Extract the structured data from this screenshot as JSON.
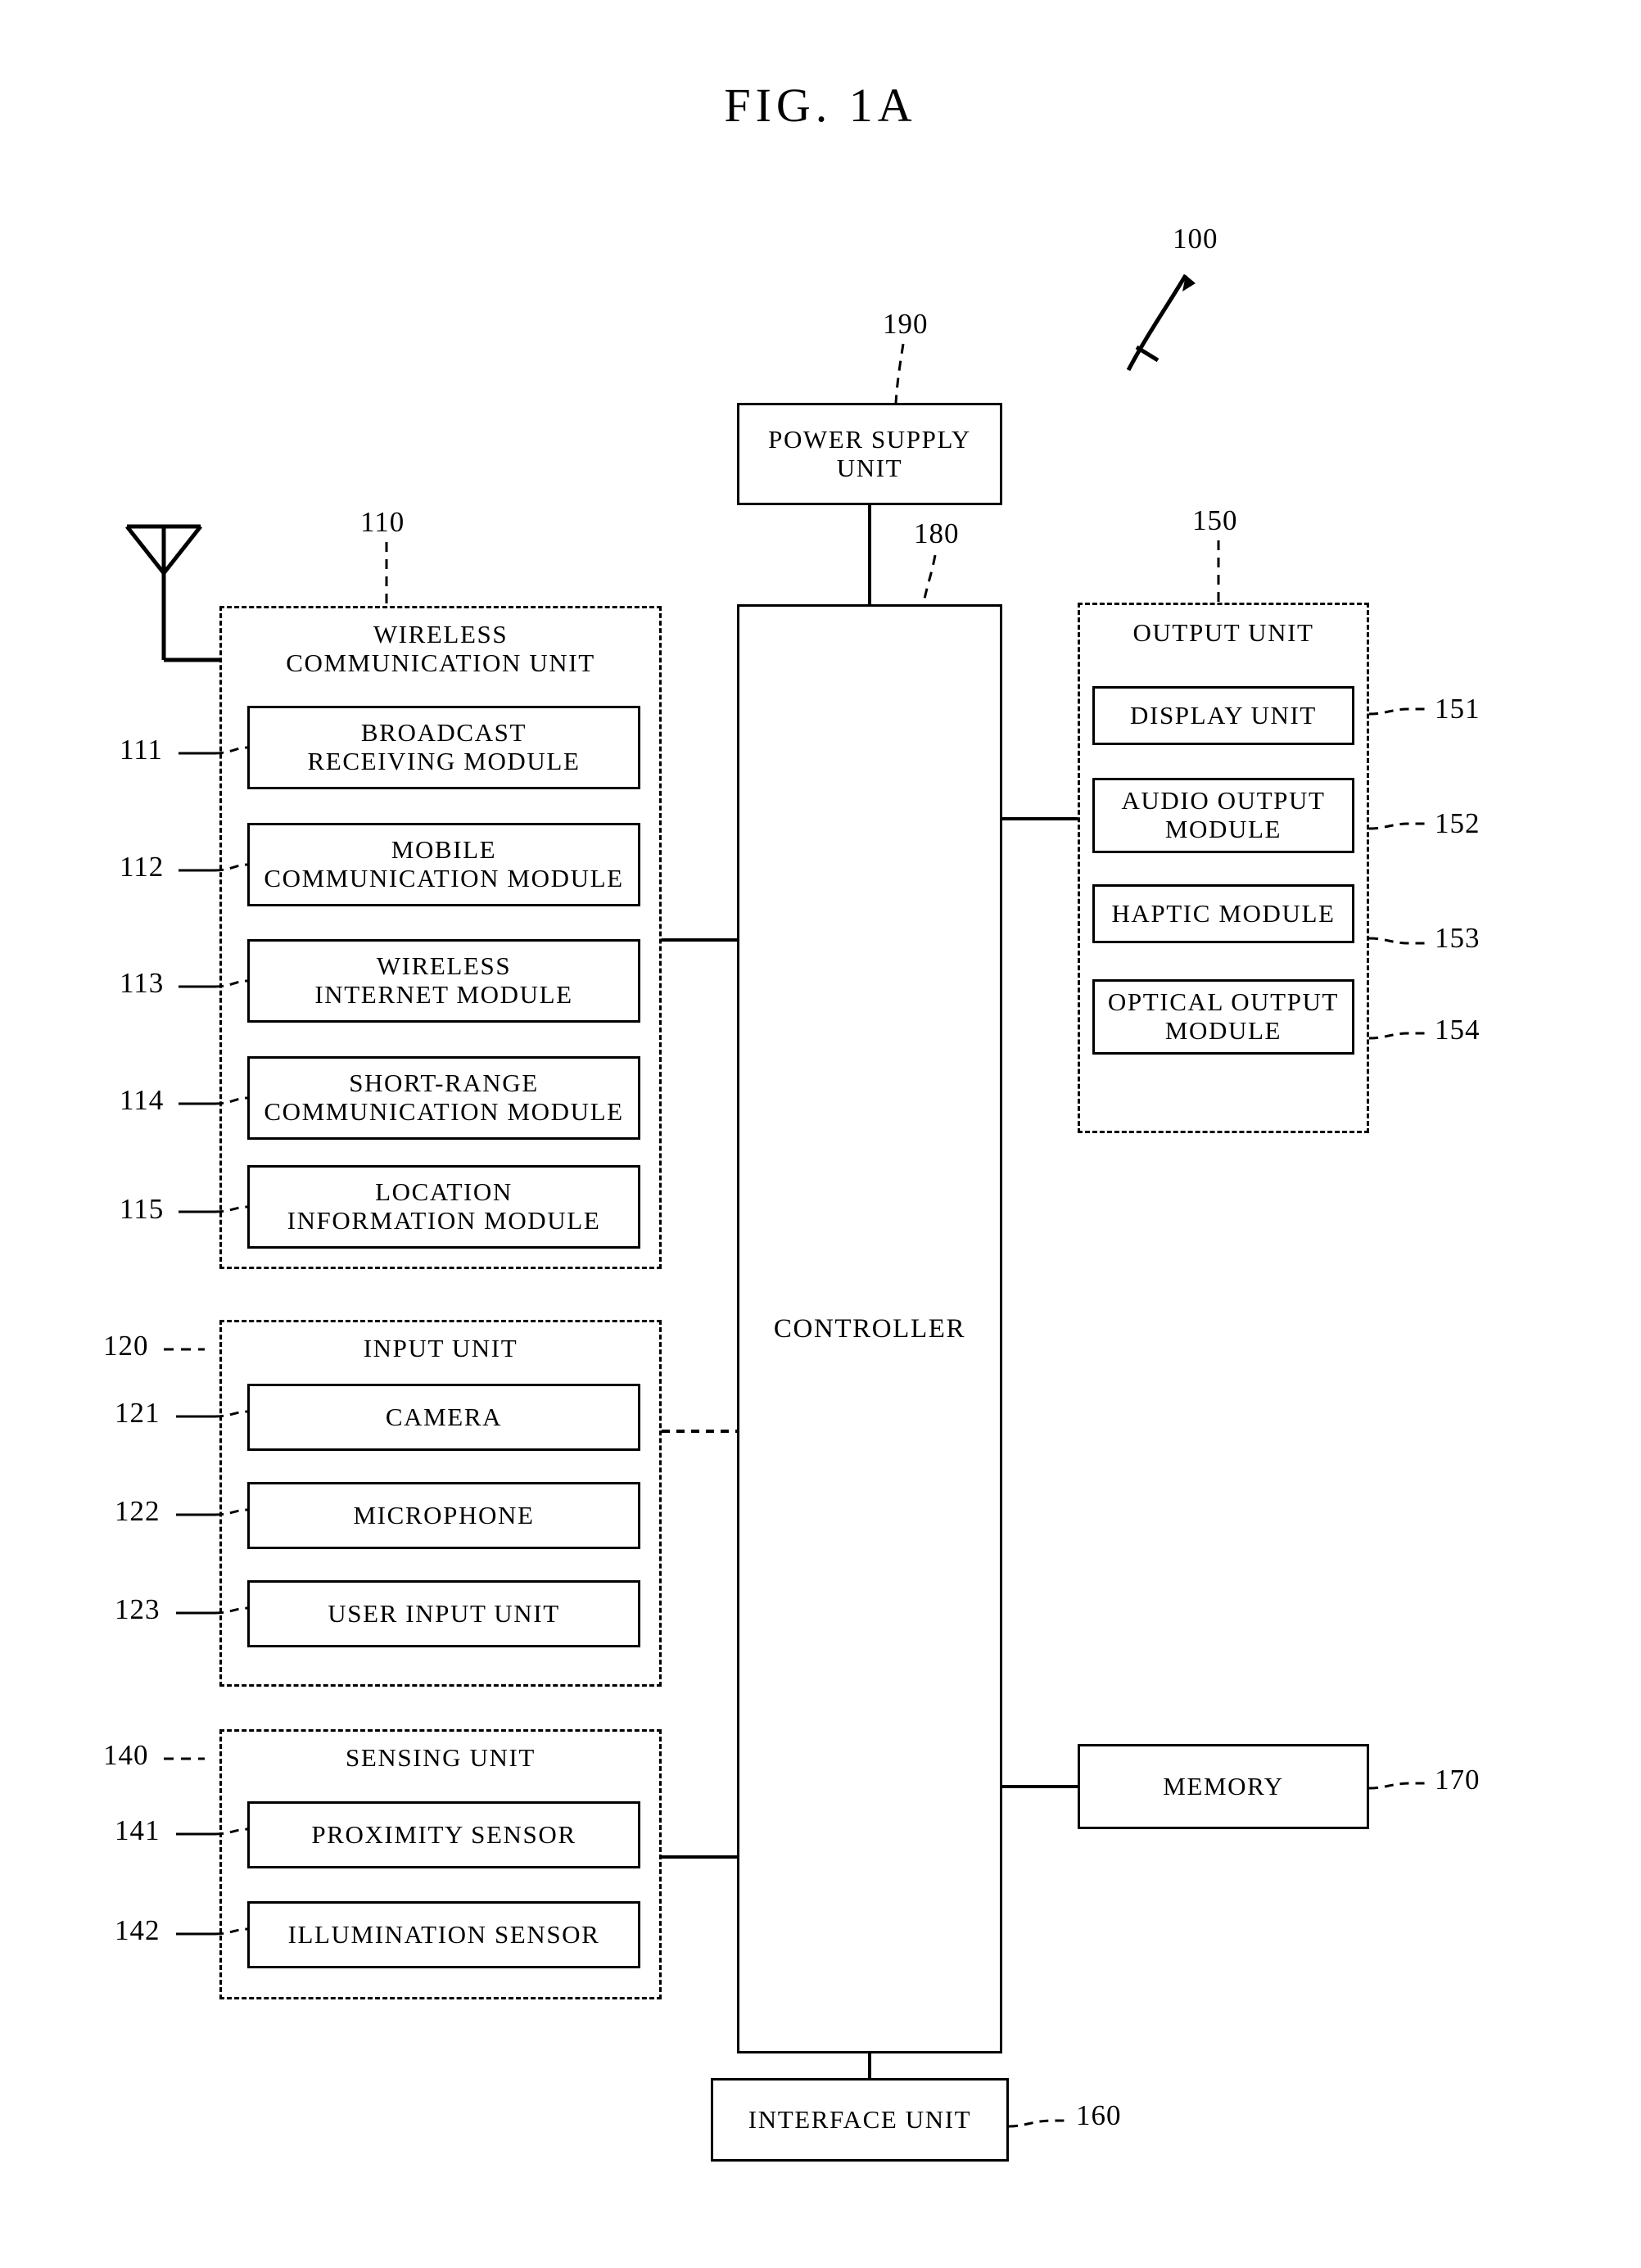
{
  "figure": {
    "title": "FIG.  1A",
    "device_ref": "100"
  },
  "power_supply": {
    "label": "POWER SUPPLY\nUNIT",
    "ref": "190"
  },
  "controller": {
    "label": "CONTROLLER",
    "ref": "180"
  },
  "wireless_communication_unit": {
    "title": "WIRELESS\nCOMMUNICATION UNIT",
    "ref": "110",
    "modules": [
      {
        "label": "BROADCAST\nRECEIVING MODULE",
        "ref": "111"
      },
      {
        "label": "MOBILE\nCOMMUNICATION MODULE",
        "ref": "112"
      },
      {
        "label": "WIRELESS\nINTERNET MODULE",
        "ref": "113"
      },
      {
        "label": "SHORT-RANGE\nCOMMUNICATION MODULE",
        "ref": "114"
      },
      {
        "label": "LOCATION\nINFORMATION MODULE",
        "ref": "115"
      }
    ]
  },
  "input_unit": {
    "title": "INPUT UNIT",
    "ref": "120",
    "modules": [
      {
        "label": "CAMERA",
        "ref": "121"
      },
      {
        "label": "MICROPHONE",
        "ref": "122"
      },
      {
        "label": "USER INPUT UNIT",
        "ref": "123"
      }
    ]
  },
  "sensing_unit": {
    "title": "SENSING UNIT",
    "ref": "140",
    "modules": [
      {
        "label": "PROXIMITY SENSOR",
        "ref": "141"
      },
      {
        "label": "ILLUMINATION SENSOR",
        "ref": "142"
      }
    ]
  },
  "output_unit": {
    "title": "OUTPUT UNIT",
    "ref": "150",
    "modules": [
      {
        "label": "DISPLAY UNIT",
        "ref": "151"
      },
      {
        "label": "AUDIO OUTPUT\nMODULE",
        "ref": "152"
      },
      {
        "label": "HAPTIC MODULE",
        "ref": "153"
      },
      {
        "label": "OPTICAL OUTPUT\nMODULE",
        "ref": "154"
      }
    ]
  },
  "memory": {
    "label": "MEMORY",
    "ref": "170"
  },
  "interface_unit": {
    "label": "INTERFACE UNIT",
    "ref": "160"
  },
  "antenna": {
    "icon": "antenna-icon"
  },
  "colors": {
    "ink": "#000000",
    "paper": "#ffffff"
  }
}
